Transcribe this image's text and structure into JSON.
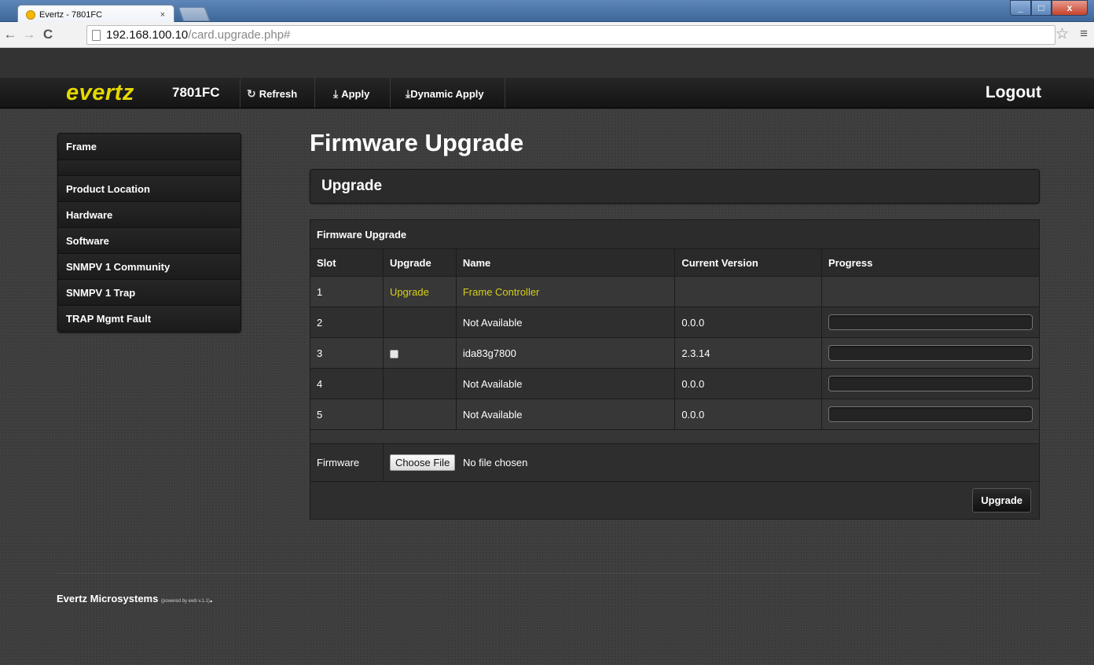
{
  "browser": {
    "tab_title": "Evertz - 7801FC",
    "tab_close": "×",
    "url_host": "192.168.100.10",
    "url_path": "/card.upgrade.php#",
    "back": "←",
    "forward": "→",
    "reload": "C",
    "star": "☆",
    "menu": "≡",
    "min": "_",
    "max": "□",
    "close": "x"
  },
  "header": {
    "logo": "evertz",
    "model": "7801FC",
    "refresh_label": "Refresh",
    "apply_label": "Apply",
    "dynamic_apply_label": "Dynamic Apply",
    "logout_label": "Logout",
    "refresh_icon": "refresh-icon",
    "apply_icon": "download-arrow-icon"
  },
  "sidebar": {
    "items": [
      {
        "label": "Frame"
      },
      {
        "label": ""
      },
      {
        "label": "Product Location"
      },
      {
        "label": "Hardware"
      },
      {
        "label": "Software"
      },
      {
        "label": "SNMPV 1 Community"
      },
      {
        "label": "SNMPV 1 Trap"
      },
      {
        "label": "TRAP Mgmt Fault"
      }
    ]
  },
  "main": {
    "page_title": "Firmware Upgrade",
    "section_title": "Upgrade",
    "table": {
      "caption": "Firmware Upgrade",
      "columns": [
        "Slot",
        "Upgrade",
        "Name",
        "Current Version",
        "Progress"
      ],
      "rows": [
        {
          "slot": "1",
          "upgrade": "Upgrade",
          "name": "Frame Controller",
          "version": "",
          "progress": null
        },
        {
          "slot": "2",
          "upgrade": "",
          "name": "Not Available",
          "version": "0.0.0",
          "progress": 0
        },
        {
          "slot": "3",
          "upgrade": "checkbox",
          "name": "ida83g7800",
          "version": "2.3.14",
          "progress": 0
        },
        {
          "slot": "4",
          "upgrade": "",
          "name": "Not Available",
          "version": "0.0.0",
          "progress": 0
        },
        {
          "slot": "5",
          "upgrade": "",
          "name": "Not Available",
          "version": "0.0.0",
          "progress": 0
        }
      ],
      "firmware_label": "Firmware",
      "choose_file_label": "Choose File",
      "no_file_text": "No file chosen",
      "upgrade_button_label": "Upgrade"
    }
  },
  "footer": {
    "company": "Evertz Microsystems",
    "powered_by": "(powered by ewb v.1.1)",
    "dot": "."
  },
  "colors": {
    "logo_yellow": "#e6d900",
    "link_yellow": "#d7cf1a"
  }
}
